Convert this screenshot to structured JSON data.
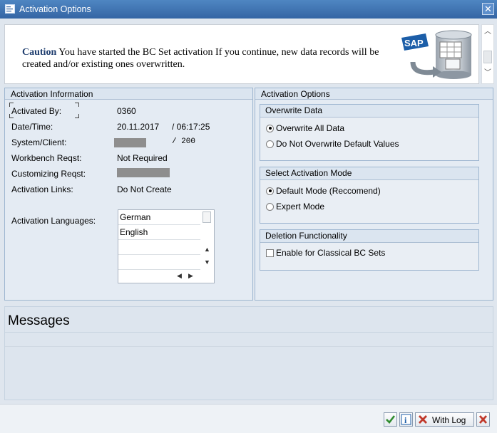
{
  "window": {
    "title": "Activation Options"
  },
  "banner": {
    "caution": "Caution",
    "message": " You have started the BC Set activation If you continue, new data records will be created and/or existing ones overwritten.",
    "logo_text": "SAP"
  },
  "info": {
    "header": "Activation Information",
    "activated_by_label": "Activated By:",
    "activated_by": "0360",
    "datetime_label": "Date/Time:",
    "date": "20.11.2017",
    "time": "/ 06:17:25",
    "system_client_label": "System/Client:",
    "client": "/ 200",
    "workbench_label": "Workbench Reqst:",
    "workbench": "Not Required",
    "customizing_label": "Customizing Reqst:",
    "links_label": "Activation Links:",
    "links": "Do Not Create",
    "languages_label": "Activation Languages:",
    "languages": [
      "German",
      "English"
    ]
  },
  "options": {
    "header": "Activation Options",
    "overwrite": {
      "title": "Overwrite Data",
      "opt1": "Overwrite All Data",
      "opt2": "Do Not Overwrite Default Values",
      "selected": "Overwrite All Data"
    },
    "mode": {
      "title": "Select Activation Mode",
      "opt1": "Default Mode (Reccomend)",
      "opt2": "Expert Mode",
      "selected": "Default Mode (Reccomend)"
    },
    "deletion": {
      "title": "Deletion Functionality",
      "checkbox": "Enable for Classical BC Sets",
      "checked": false
    }
  },
  "messages": {
    "title": "Messages"
  },
  "footer": {
    "with_log": "With Log"
  },
  "colors": {
    "title_bar": "#3e72b3",
    "accept": "#2e8b2e",
    "cancel": "#c0392b",
    "info": "#1f5fa8"
  }
}
